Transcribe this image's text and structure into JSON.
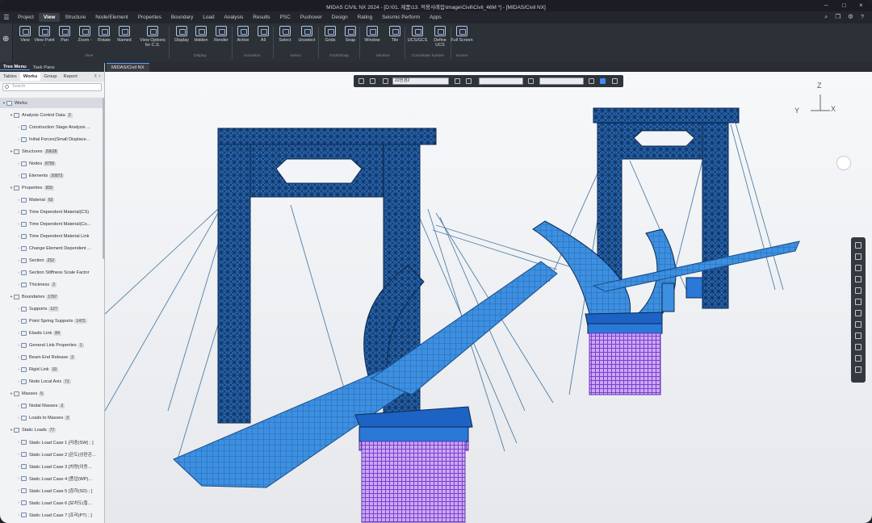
{
  "titlebar": {
    "title": "MIDAS CIVIL NX 2024 - [D:\\01. 제품\\13. 적용사례집\\image\\Civil\\Civil_46M *] - [MIDAS/Civil NX]"
  },
  "menu": {
    "items": [
      "Project",
      "View",
      "Structure",
      "Node/Element",
      "Properties",
      "Boundary",
      "Load",
      "Analysis",
      "Results",
      "PSC",
      "Pushover",
      "Design",
      "Rating",
      "Seismic Perform",
      "Apps"
    ],
    "active": "View"
  },
  "ribbon": {
    "buttons": [
      "View",
      "View Point -",
      "Pan",
      "Zoom -",
      "Rotate",
      "Named",
      "View Options for C.S.",
      "Display",
      "Hidden",
      "Render",
      "Active",
      "All",
      "Select",
      "Unselect",
      "Grids",
      "Snap",
      "Window",
      "Tile",
      "UCS/GCS",
      "Define UCS",
      "Full Screen"
    ],
    "groups": [
      "View",
      "Display",
      "Activation",
      "Select",
      "Grids/Snap",
      "Window",
      "Coordinate System",
      "Screen"
    ]
  },
  "panel": {
    "tabs": [
      "Tree Menu",
      "Task Pane"
    ],
    "subtabs": [
      "Tables",
      "Works",
      "Group",
      "Report"
    ],
    "search_placeholder": "Search",
    "tree": [
      {
        "label": "Works",
        "count": "",
        "level": 0
      },
      {
        "label": "Analysis Control Data",
        "count": "2",
        "level": 1
      },
      {
        "label": "Construction Stage Analysis ...",
        "count": "",
        "level": 2
      },
      {
        "label": "Initial Forces(Small Displace...",
        "count": "",
        "level": 2
      },
      {
        "label": "Structures",
        "count": "29628",
        "level": 1
      },
      {
        "label": "Nodes",
        "count": "8755",
        "level": 2
      },
      {
        "label": "Elements",
        "count": "20873",
        "level": 2
      },
      {
        "label": "Properties",
        "count": "659",
        "level": 1
      },
      {
        "label": "Material",
        "count": "63",
        "level": 2
      },
      {
        "label": "Time Dependent Material(CS)",
        "count": "",
        "level": 2
      },
      {
        "label": "Time Dependent Material(Co...",
        "count": "",
        "level": 2
      },
      {
        "label": "Time Dependent Material Link",
        "count": "",
        "level": 2
      },
      {
        "label": "Change Element Dependent ...",
        "count": "",
        "level": 2
      },
      {
        "label": "Section",
        "count": "252",
        "level": 2
      },
      {
        "label": "Section Stiffness Scale Factor",
        "count": "",
        "level": 2
      },
      {
        "label": "Thickness",
        "count": "2",
        "level": 2
      },
      {
        "label": "Boundaries",
        "count": "1767",
        "level": 1
      },
      {
        "label": "Supports",
        "count": "127",
        "level": 2
      },
      {
        "label": "Point Spring Supports",
        "count": "1472",
        "level": 2
      },
      {
        "label": "Elastic Link",
        "count": "84",
        "level": 2
      },
      {
        "label": "General Link Properties",
        "count": "1",
        "level": 2
      },
      {
        "label": "Beam End Release",
        "count": "2",
        "level": 2
      },
      {
        "label": "Rigid Link",
        "count": "10",
        "level": 2
      },
      {
        "label": "Node Local Axis",
        "count": "71",
        "level": 2
      },
      {
        "label": "Masses",
        "count": "5",
        "level": 1
      },
      {
        "label": "Nodal Masses",
        "count": "2",
        "level": 2
      },
      {
        "label": "Loads to Masses",
        "count": "3",
        "level": 2
      },
      {
        "label": "Static Loads",
        "count": "77",
        "level": 1
      },
      {
        "label": "Static Load Case 1 [자중(SW) ; ]",
        "count": "",
        "level": 2
      },
      {
        "label": "Static Load Case 2 [온도(상판온...",
        "count": "",
        "level": 2
      },
      {
        "label": "Static Load Case 3 [차량(이동...",
        "count": "",
        "level": 2
      },
      {
        "label": "Static Load Case 4 [풍압(WP)...",
        "count": "",
        "level": 2
      },
      {
        "label": "Static Load Case 5 [침하(SD) ; ]",
        "count": "",
        "level": 2
      },
      {
        "label": "Static Load Case 6 [보차도(횡...",
        "count": "",
        "level": 2
      },
      {
        "label": "Static Load Case 7 [프리(PT) ; ]",
        "count": "",
        "level": 2
      }
    ]
  },
  "document": {
    "tab": "MIDAS/Civil NX",
    "view_combo": "22한경2",
    "axes": {
      "z": "Z",
      "y": "Y",
      "x": "X"
    }
  },
  "colors": {
    "accent": "#3d8cff",
    "steel": "#1d4f8a",
    "piles": "#8a4fd6"
  }
}
